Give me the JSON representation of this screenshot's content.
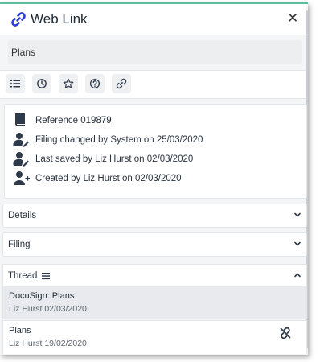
{
  "header": {
    "title": "Web Link",
    "close_label": "✕"
  },
  "record": {
    "name": "Plans"
  },
  "toolbar": {
    "buttons": [
      {
        "icon": "list-icon"
      },
      {
        "icon": "clock-icon"
      },
      {
        "icon": "star-icon"
      },
      {
        "icon": "help-icon"
      },
      {
        "icon": "link-icon"
      }
    ]
  },
  "info": {
    "reference": "Reference 019879",
    "filing_changed": "Filing changed by System on 25/03/2020",
    "last_saved": "Last saved by Liz Hurst on 02/03/2020",
    "created": "Created by Liz Hurst on 02/03/2020"
  },
  "sections": {
    "details": "Details",
    "filing": "Filing"
  },
  "thread": {
    "label": "Thread",
    "items": [
      {
        "title": "DocuSign: Plans",
        "subtitle": "Liz Hurst 02/03/2020"
      },
      {
        "title": "Plans",
        "subtitle": "Liz Hurst 19/02/2020"
      }
    ]
  },
  "colors": {
    "accent": "#5bbf9c",
    "link_icon": "#2a3bd6",
    "icon_dark": "#2f3a4a",
    "selected_row": "#e8eaed"
  }
}
